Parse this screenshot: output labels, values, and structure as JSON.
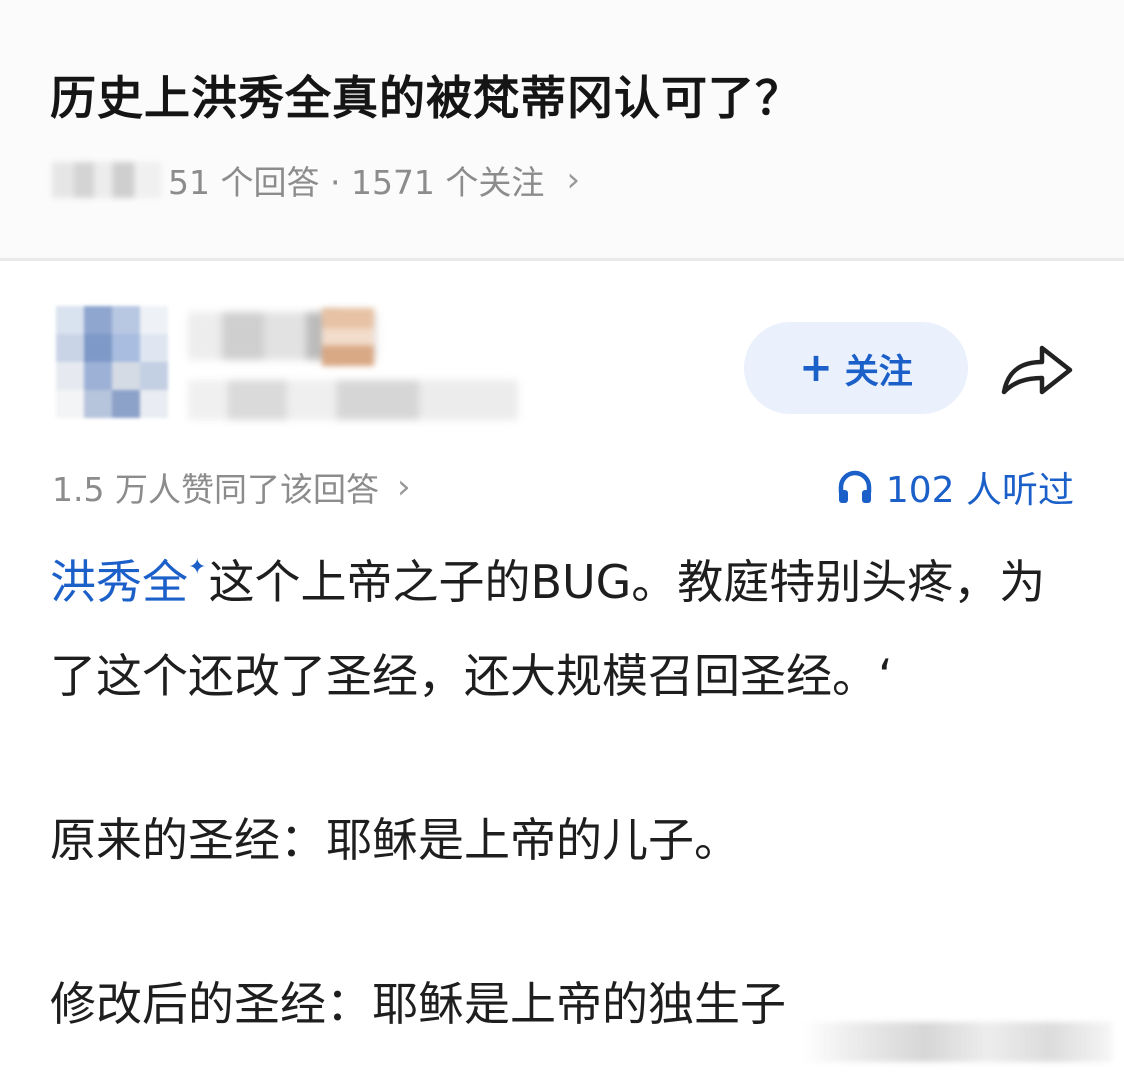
{
  "question": {
    "title": "历史上洪秀全真的被梵蒂冈认可了？",
    "meta": "51 个回答 · 1571 个关注",
    "meta_chevron": "›"
  },
  "author": {
    "follow_plus": "+",
    "follow_label": "关注"
  },
  "stats": {
    "upvote_text": "1.5 万人赞同了该回答",
    "upvote_chevron": "›",
    "listen_text": "102 人听过"
  },
  "answer": {
    "entity_link": "洪秀全",
    "sparkle": "✦",
    "para1_rest": "这个上帝之子的BUG。教庭特别头疼，为了这个还改了圣经，还大规模召回圣经。‘",
    "para2": "原来的圣经：耶稣是上帝的儿子。",
    "para3": "修改后的圣经：耶稣是上帝的独生子"
  },
  "colors": {
    "accent_blue": "#1b5fc9",
    "follow_bg": "#eaf1fc",
    "meta_gray": "#8c8c8c"
  },
  "icons": {
    "share": "share-arrow-icon",
    "headphone": "headphone-icon",
    "chevron": "chevron-right-icon"
  }
}
